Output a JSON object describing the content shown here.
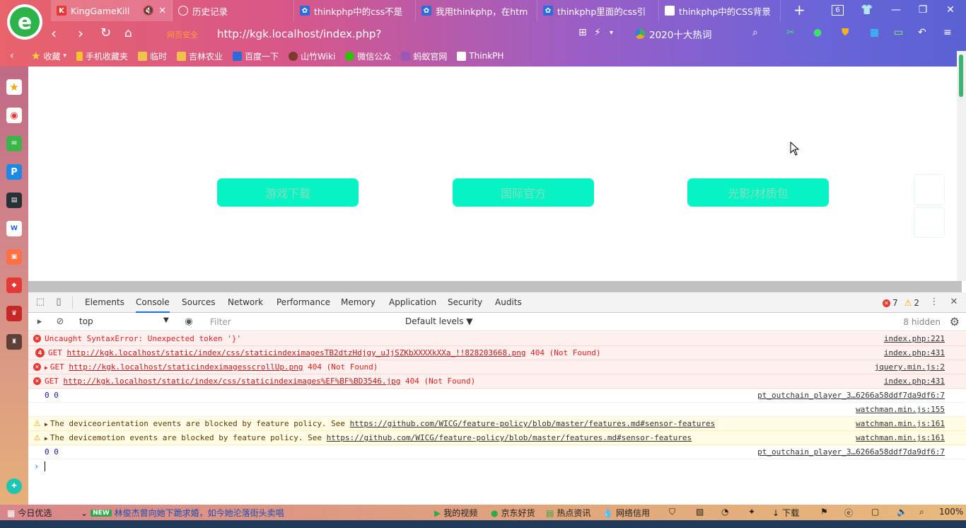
{
  "browser": {
    "tabs": [
      {
        "label": "KingGameKill",
        "icon": "k-icon",
        "active": true
      },
      {
        "label": "历史记录",
        "icon": "clock-icon"
      },
      {
        "label": "thinkphp中的css不是",
        "icon": "baidu-icon"
      },
      {
        "label": "我用thinkphp，在htm",
        "icon": "baidu-icon"
      },
      {
        "label": "thinkphp里面的css引",
        "icon": "baidu-icon"
      },
      {
        "label": "thinkphp中的CSS背景",
        "icon": "doc-icon"
      }
    ],
    "tab_count": "6",
    "url_prefix": "网页安全",
    "url": "http://kgk.localhost/index.php?",
    "hot_search": "2020十大热词"
  },
  "bookmarks": [
    "收藏",
    "手机收藏夹",
    "临时",
    "吉林农业",
    "百度一下",
    "山竹Wiki",
    "微信公众",
    "蚂蚁官网",
    "ThinkPH"
  ],
  "page": {
    "buttons": [
      "游戏下载",
      "国际官方",
      "光影/材质包"
    ],
    "button_color": "#08f3c3"
  },
  "devtools": {
    "tabs": [
      "Elements",
      "Console",
      "Sources",
      "Network",
      "Performance",
      "Memory",
      "Application",
      "Security",
      "Audits"
    ],
    "active_tab": "Console",
    "error_count": "7",
    "warning_count": "2",
    "context": "top",
    "filter_placeholder": "Filter",
    "levels": "Default levels ▼",
    "hidden": "8 hidden",
    "messages": [
      {
        "type": "error",
        "pre": "Uncaught SyntaxError: Unexpected token '}'",
        "link": "",
        "post": "",
        "source": "index.php:221"
      },
      {
        "type": "error",
        "count": "4",
        "pre": "GET ",
        "link": "http://kgk.localhost/static/index/css/staticindeximagesTB2dtzHdjgy_uJjSZKbXXXXkXXa_!!828203668.png",
        "post": " 404 (Not Found)",
        "source": "index.php:431"
      },
      {
        "type": "error",
        "expand": true,
        "pre": "GET ",
        "link": "http://kgk.localhost/staticindeximagesscrollUp.png",
        "post": " 404 (Not Found)",
        "source": "jquery.min.js:2"
      },
      {
        "type": "error",
        "pre": "GET ",
        "link": "http://kgk.localhost/static/index/css/staticindeximages%EF%BF%BD3546.jpg",
        "post": " 404 (Not Found)",
        "source": "index.php:431"
      },
      {
        "type": "info",
        "pre": "0 0",
        "link": "",
        "post": "",
        "source": "pt_outchain_player_3…6266a58ddf7da9df6:7"
      },
      {
        "type": "info",
        "pre": "",
        "link": "",
        "post": "",
        "source": "watchman.min.js:155"
      },
      {
        "type": "warn",
        "expand": true,
        "pre": "The deviceorientation events are blocked by feature policy. See ",
        "link": "https://github.com/WICG/feature-policy/blob/master/features.md#sensor-features",
        "post": "",
        "source": "watchman.min.js:161"
      },
      {
        "type": "warn",
        "expand": true,
        "pre": "The devicemotion events are blocked by feature policy. See ",
        "link": "https://github.com/WICG/feature-policy/blob/master/features.md#sensor-features",
        "post": "",
        "source": "watchman.min.js:161"
      },
      {
        "type": "info",
        "pre": "0 0",
        "link": "",
        "post": "",
        "source": "pt_outchain_player_3…6266a58ddf7da9df6:7"
      }
    ]
  },
  "statusbar": {
    "today": "今日优选",
    "new_badge": "NEW",
    "news": "林俊杰曾向她下跪求婚，如今她沦落街头卖唱",
    "items": [
      "我的视频",
      "京东好货",
      "热点资讯",
      "网络信用",
      "下载"
    ],
    "zoom": "100%"
  }
}
